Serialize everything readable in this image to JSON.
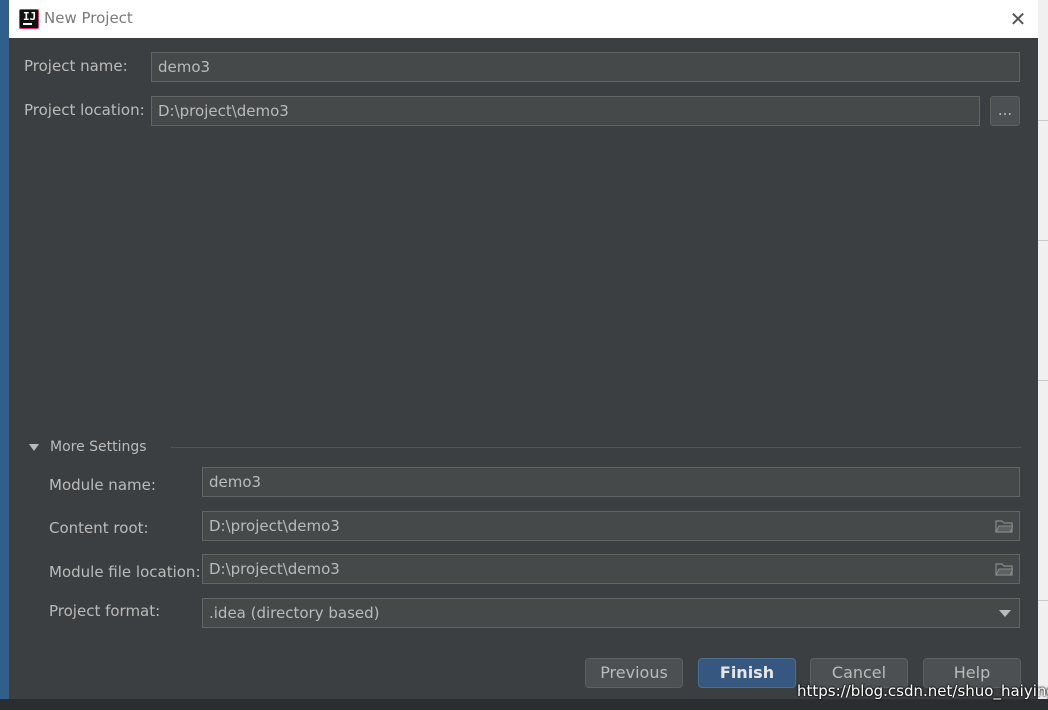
{
  "window": {
    "title": "New Project",
    "close_glyph": "✕"
  },
  "form": {
    "project_name_label": "Project name:",
    "project_name_value": "demo3",
    "project_location_label": "Project location:",
    "project_location_value": "D:\\project\\demo3",
    "browse_label": "..."
  },
  "more_settings": {
    "header": "More Settings",
    "module_name_label": "Module name:",
    "module_name_value": "demo3",
    "content_root_label": "Content root:",
    "content_root_value": "D:\\project\\demo3",
    "module_file_location_label": "Module file location:",
    "module_file_location_value": "D:\\project\\demo3",
    "project_format_label": "Project format:",
    "project_format_value": ".idea (directory based)"
  },
  "buttons": {
    "previous": "Previous",
    "finish": "Finish",
    "cancel": "Cancel",
    "help": "Help"
  },
  "watermark": "https://blog.csdn.net/shuo_haiying",
  "icons": [
    "intellij-app-icon",
    "close-icon",
    "folder-icon",
    "triangle-down-icon",
    "chevron-down-icon"
  ]
}
